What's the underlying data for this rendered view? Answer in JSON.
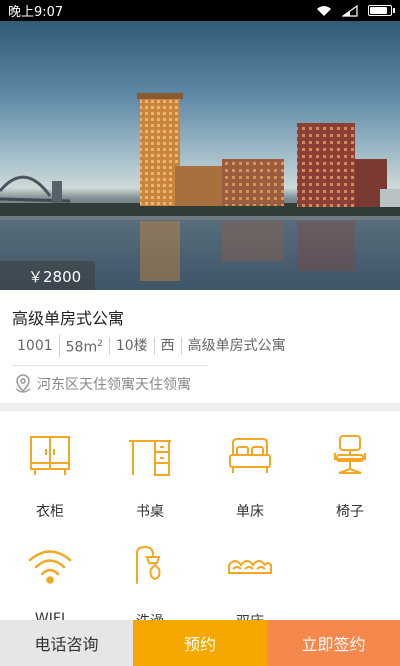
{
  "status_bar": {
    "time": "晚上9:07"
  },
  "listing": {
    "price": "￥2800",
    "title": "高级单房式公寓",
    "tags": [
      "1001",
      "58m",
      "10楼",
      "西",
      "高级单房式公寓"
    ],
    "area_unit_sup": "2",
    "address": "河东区天住领寓天住领寓"
  },
  "facilities": [
    {
      "label": "衣柜",
      "icon": "wardrobe-icon"
    },
    {
      "label": "书桌",
      "icon": "desk-icon"
    },
    {
      "label": "单床",
      "icon": "single-bed-icon"
    },
    {
      "label": "椅子",
      "icon": "chair-icon"
    },
    {
      "label": "WIFI",
      "icon": "wifi-icon"
    },
    {
      "label": "洗澡",
      "icon": "shower-icon"
    },
    {
      "label": "双床",
      "icon": "double-bed-icon"
    }
  ],
  "bottom_bar": {
    "call_label": "电话咨询",
    "reserve_label": "预约",
    "sign_label": "立即签约"
  },
  "colors": {
    "accent": "#f7a800",
    "sign": "#f5884d",
    "icon": "#f5a623"
  }
}
